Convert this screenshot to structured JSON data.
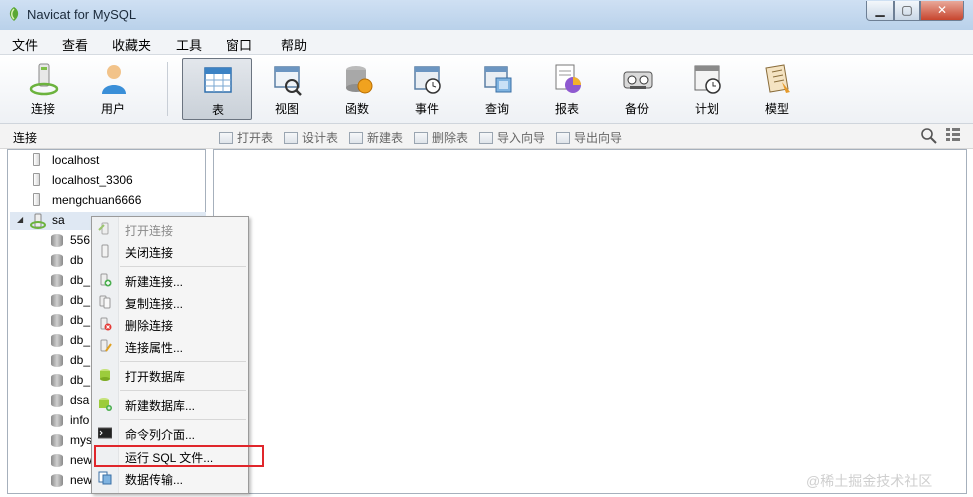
{
  "window": {
    "title": "Navicat for MySQL"
  },
  "menu": [
    "文件",
    "查看",
    "收藏夹",
    "工具",
    "窗口",
    "帮助"
  ],
  "toolbar": [
    {
      "label": "连接",
      "icon": "connection-icon"
    },
    {
      "label": "用户",
      "icon": "user-icon"
    },
    {
      "label": "表",
      "icon": "table-icon",
      "active": true
    },
    {
      "label": "视图",
      "icon": "view-icon"
    },
    {
      "label": "函数",
      "icon": "function-icon"
    },
    {
      "label": "事件",
      "icon": "event-icon"
    },
    {
      "label": "查询",
      "icon": "query-icon"
    },
    {
      "label": "报表",
      "icon": "report-icon"
    },
    {
      "label": "备份",
      "icon": "backup-icon"
    },
    {
      "label": "计划",
      "icon": "schedule-icon"
    },
    {
      "label": "模型",
      "icon": "model-icon"
    }
  ],
  "subheader": {
    "label": "连接",
    "actions": [
      "打开表",
      "设计表",
      "新建表",
      "删除表",
      "导入向导",
      "导出向导"
    ]
  },
  "tree": {
    "connections": [
      "localhost",
      "localhost_3306",
      "mengchuan6666",
      "sa"
    ],
    "databases": [
      "556",
      "db",
      "db_",
      "db_",
      "db_",
      "db_",
      "db_",
      "db_",
      "dsa",
      "info",
      "mys",
      "new",
      "new"
    ]
  },
  "context_menu": [
    {
      "label": "打开连接",
      "disabled": true,
      "icon": "open-connection-icon"
    },
    {
      "label": "关闭连接",
      "icon": "close-connection-icon"
    },
    {
      "label": "新建连接...",
      "icon": "new-connection-icon"
    },
    {
      "label": "复制连接...",
      "icon": "copy-connection-icon"
    },
    {
      "label": "删除连接",
      "icon": "delete-connection-icon"
    },
    {
      "label": "连接属性...",
      "icon": "connection-properties-icon"
    },
    {
      "label": "打开数据库",
      "icon": "open-database-icon"
    },
    {
      "label": "新建数据库...",
      "icon": "new-database-icon"
    },
    {
      "label": "命令列介面...",
      "icon": "console-icon"
    },
    {
      "label": "运行 SQL 文件...",
      "icon": "run-sql-file-icon",
      "highlighted": true
    },
    {
      "label": "数据传输...",
      "icon": "data-transfer-icon"
    }
  ],
  "watermark": "@稀土掘金技术社区",
  "colors": {
    "highlight": "#e0262b",
    "selection": "#dfe8f3"
  }
}
